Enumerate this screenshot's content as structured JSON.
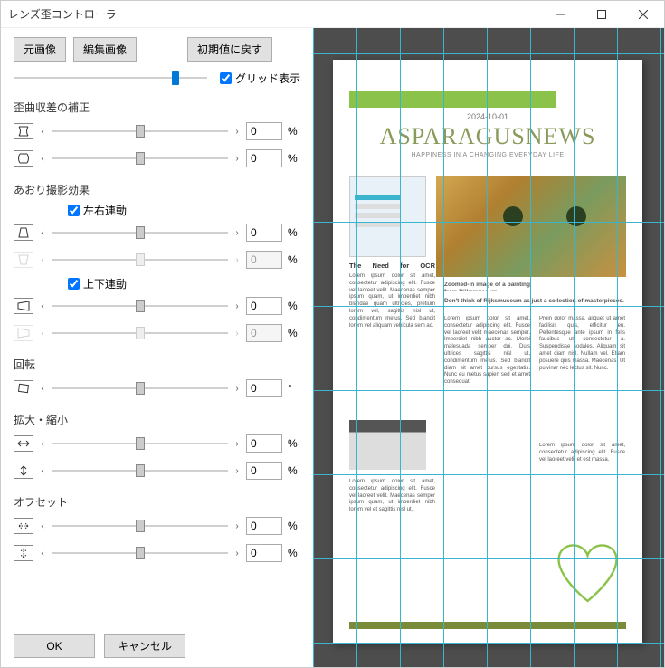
{
  "window": {
    "title": "レンズ歪コントローラ"
  },
  "toolbar": {
    "original_image": "元画像",
    "edited_image": "編集画像",
    "reset_defaults": "初期値に戻す"
  },
  "grid_display": {
    "label": "グリッド表示",
    "checked": true
  },
  "sections": {
    "distortion": {
      "label": "歪曲収差の補正",
      "row1": {
        "value": "0",
        "unit": "%"
      },
      "row2": {
        "value": "0",
        "unit": "%"
      }
    },
    "tilt": {
      "label": "あおり撮影効果",
      "lr_link": {
        "label": "左右連動",
        "checked": true
      },
      "row1": {
        "value": "0",
        "unit": "%"
      },
      "row2": {
        "value": "0",
        "unit": "%",
        "disabled": true
      },
      "ud_link": {
        "label": "上下連動",
        "checked": true
      },
      "row3": {
        "value": "0",
        "unit": "%"
      },
      "row4": {
        "value": "0",
        "unit": "%",
        "disabled": true
      }
    },
    "rotation": {
      "label": "回転",
      "row1": {
        "value": "0",
        "unit": "°"
      }
    },
    "scale": {
      "label": "拡大・縮小",
      "row1": {
        "value": "0",
        "unit": "%"
      },
      "row2": {
        "value": "0",
        "unit": "%"
      }
    },
    "offset": {
      "label": "オフセット",
      "row1": {
        "value": "0",
        "unit": "%"
      },
      "row2": {
        "value": "0",
        "unit": "%"
      }
    }
  },
  "buttons": {
    "ok": "OK",
    "cancel": "キャンセル"
  },
  "preview": {
    "date": "2024-10-01",
    "title": "ASPARAGUSNEWS",
    "subtitle": "HAPPINESS IN A CHANGING EVERYDAY LIFE",
    "heading1": "The Need for OCR Software",
    "caption1": "Zoomed-in image of a painting from Rijksmuseum",
    "caption2": "Don't think of Rijksmuseum as just a collection of masterpieces."
  }
}
